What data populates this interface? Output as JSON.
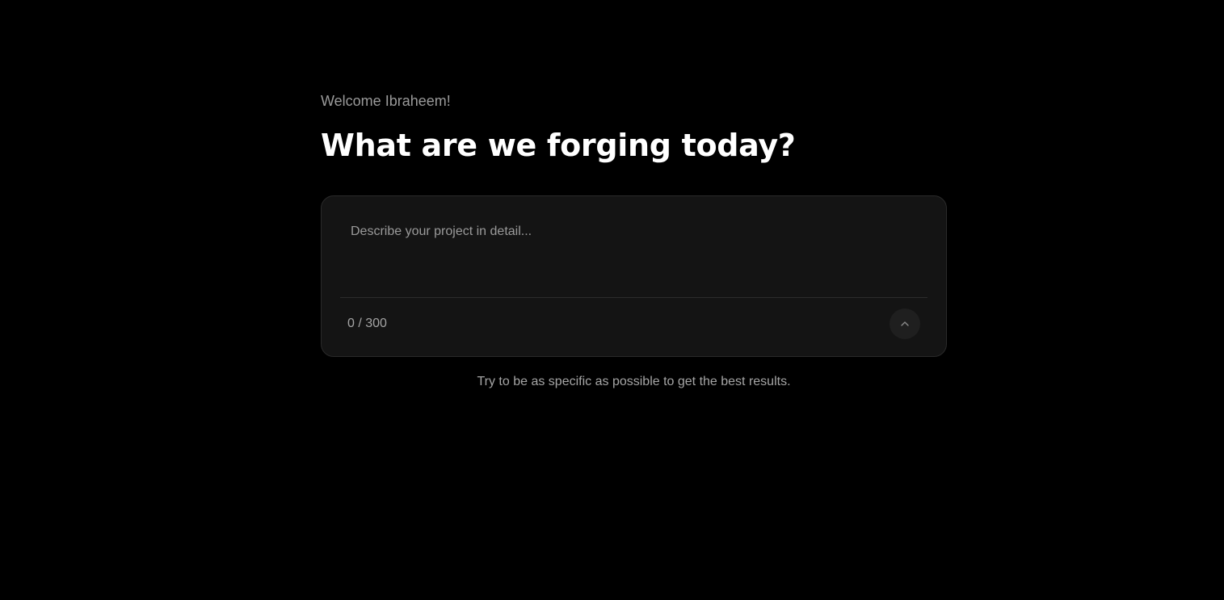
{
  "greeting": "Welcome Ibraheem!",
  "headline": "What are we forging today?",
  "prompt": {
    "value": "",
    "placeholder": "Describe your project in detail...",
    "char_count": "0 / 300"
  },
  "submit": {
    "icon": "chevron-up-icon",
    "aria_label": "Submit"
  },
  "hint": "Try to be as specific as possible to get the best results.",
  "colors": {
    "background": "#000000",
    "card": "#141414",
    "card_border": "#2a2a2a",
    "headline": "#ffffff",
    "muted_text": "#9a9a9a",
    "button": "#1f1f1f"
  }
}
